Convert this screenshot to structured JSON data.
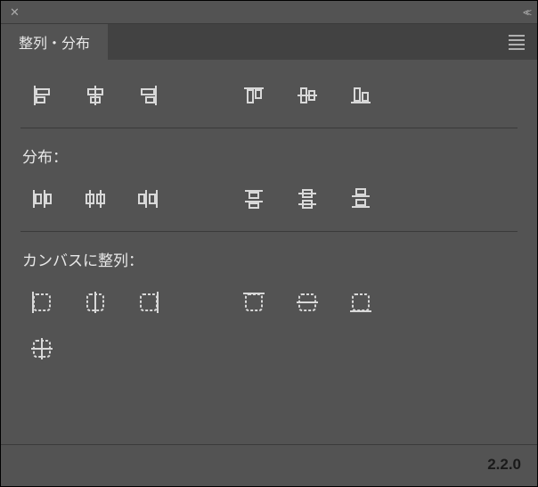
{
  "tab": {
    "label": "整列・分布"
  },
  "sections": {
    "distribute_label": "分布：",
    "canvas_align_label": "カンバスに整列："
  },
  "version": "2.2.0",
  "icons": {
    "align_left": "align-left-icon",
    "align_hcenter": "align-hcenter-icon",
    "align_right": "align-right-icon",
    "align_top": "align-top-icon",
    "align_vcenter": "align-vcenter-icon",
    "align_bottom": "align-bottom-icon",
    "dist_left": "distribute-left-icon",
    "dist_hcenter": "distribute-hcenter-icon",
    "dist_right": "distribute-right-icon",
    "dist_top": "distribute-top-icon",
    "dist_vcenter": "distribute-vcenter-icon",
    "dist_bottom": "distribute-bottom-icon",
    "canvas_left": "canvas-align-left-icon",
    "canvas_hcenter": "canvas-align-hcenter-icon",
    "canvas_right": "canvas-align-right-icon",
    "canvas_top": "canvas-align-top-icon",
    "canvas_vcenter": "canvas-align-vcenter-icon",
    "canvas_bottom": "canvas-align-bottom-icon",
    "canvas_center": "canvas-align-center-icon"
  }
}
